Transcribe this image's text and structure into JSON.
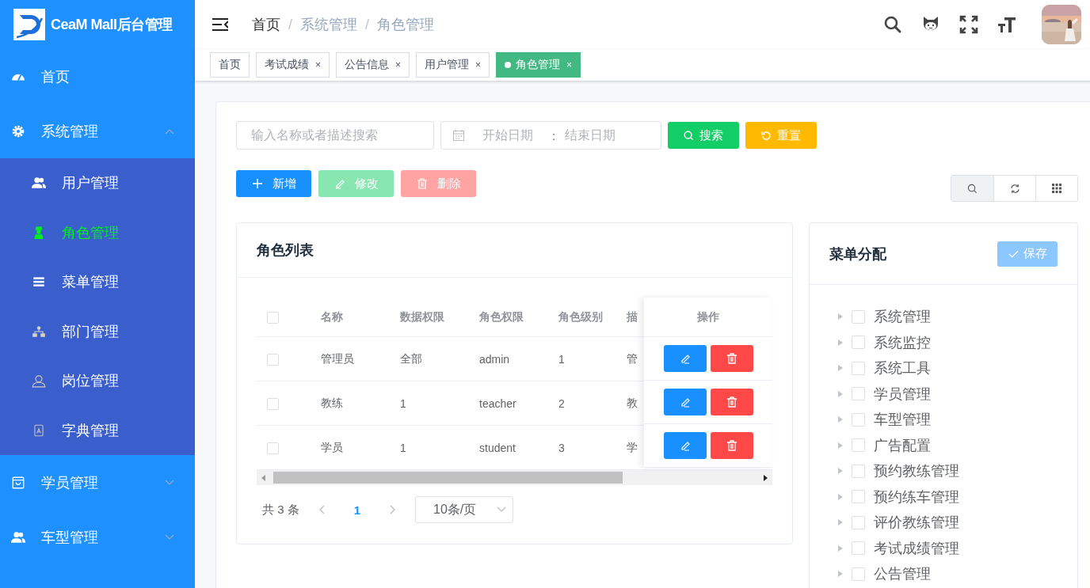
{
  "sidebar": {
    "logo_text": "CeaM Mall后台管理",
    "items": [
      {
        "label": "首页",
        "selected": false
      },
      {
        "label": "系统管理",
        "selected": false,
        "expanded": true,
        "children": [
          {
            "label": "用户管理",
            "selected": false
          },
          {
            "label": "角色管理",
            "selected": true
          },
          {
            "label": "菜单管理",
            "selected": false
          },
          {
            "label": "部门管理",
            "selected": false
          },
          {
            "label": "岗位管理",
            "selected": false
          },
          {
            "label": "字典管理",
            "selected": false
          }
        ]
      },
      {
        "label": "学员管理",
        "selected": false,
        "expanded": false
      },
      {
        "label": "车型管理",
        "selected": false,
        "expanded": false
      }
    ]
  },
  "header": {
    "breadcrumb": [
      "首页",
      "系统管理",
      "角色管理"
    ],
    "separator": "/"
  },
  "tabs": [
    {
      "label": "首页",
      "selected": false
    },
    {
      "label": "考试成绩",
      "selected": false,
      "close": "×"
    },
    {
      "label": "公告信息",
      "selected": false,
      "close": "×"
    },
    {
      "label": "用户管理",
      "selected": false,
      "close": "×"
    },
    {
      "label": "角色管理",
      "selected": true,
      "close": "×"
    }
  ],
  "filters": {
    "search": {
      "placeholder": "输入名称或者描述搜索"
    },
    "date_range": {
      "start_placeholder": "开始日期",
      "separator": ":",
      "end_placeholder": "结束日期"
    },
    "buttons": [
      {
        "label": "搜索",
        "kind": "search"
      },
      {
        "label": "重置",
        "kind": "reset"
      }
    ]
  },
  "actions": [
    {
      "label": "新增",
      "kind": "add",
      "disabled": false
    },
    {
      "label": "修改",
      "kind": "edit",
      "disabled": true
    },
    {
      "label": "删除",
      "kind": "delete",
      "disabled": true
    }
  ],
  "view_tools": [
    {
      "kind": "search",
      "selected": true
    },
    {
      "kind": "refresh",
      "selected": false
    },
    {
      "kind": "columns",
      "selected": false
    }
  ],
  "role_list": {
    "title": "角色列表",
    "header_checked": false,
    "columns": [
      "名称",
      "数据权限",
      "角色权限",
      "角色级别",
      "描"
    ],
    "action_column": "操作",
    "rows": [
      {
        "checked": false,
        "cells": [
          "管理员",
          "全部",
          "admin",
          "1",
          "管"
        ]
      },
      {
        "checked": false,
        "cells": [
          "教练",
          "1",
          "teacher",
          "2",
          "教"
        ]
      },
      {
        "checked": false,
        "cells": [
          "学员",
          "1",
          "student",
          "3",
          "学"
        ]
      }
    ],
    "pagination": {
      "total": "共 3 条",
      "pages": [
        {
          "label": "1",
          "selected": true
        }
      ],
      "page_size": "10条/页"
    }
  },
  "menu_assign": {
    "title": "菜单分配",
    "save": {
      "label": "保存",
      "disabled": true
    },
    "tree": [
      {
        "label": "系统管理",
        "checked": false,
        "expanded": false
      },
      {
        "label": "系统监控",
        "checked": false,
        "expanded": false
      },
      {
        "label": "系统工具",
        "checked": false,
        "expanded": false
      },
      {
        "label": "学员管理",
        "checked": false,
        "expanded": false
      },
      {
        "label": "车型管理",
        "checked": false,
        "expanded": false
      },
      {
        "label": "广告配置",
        "checked": false,
        "expanded": false
      },
      {
        "label": "预约教练管理",
        "checked": false,
        "expanded": false
      },
      {
        "label": "预约练车管理",
        "checked": false,
        "expanded": false
      },
      {
        "label": "评价教练管理",
        "checked": false,
        "expanded": false
      },
      {
        "label": "考试成绩管理",
        "checked": false,
        "expanded": false
      },
      {
        "label": "公告管理",
        "checked": false,
        "expanded": false
      }
    ]
  }
}
